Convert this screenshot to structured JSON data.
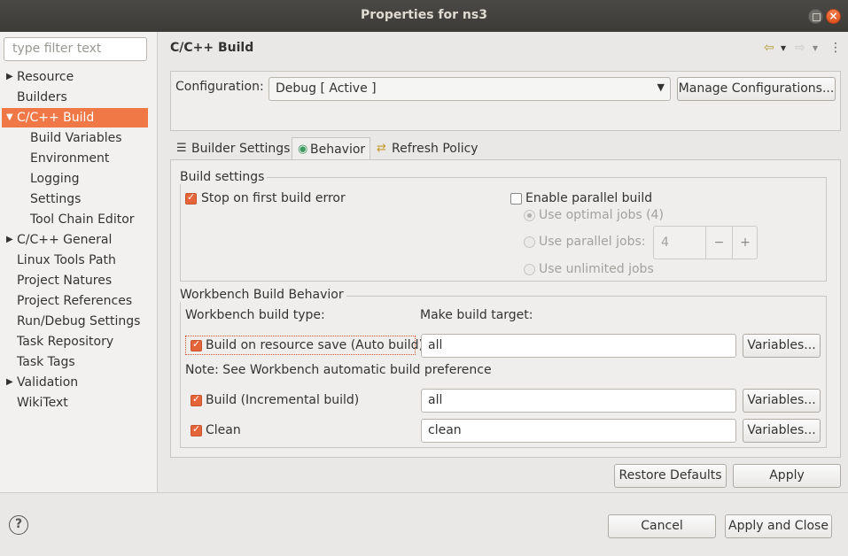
{
  "window": {
    "title": "Properties for ns3"
  },
  "filter": {
    "placeholder": "type filter text"
  },
  "tree": {
    "resource": "Resource",
    "builders": "Builders",
    "cc_build": "C/C++ Build",
    "build_variables": "Build Variables",
    "environment": "Environment",
    "logging": "Logging",
    "settings": "Settings",
    "tool_chain_editor": "Tool Chain Editor",
    "cc_general": "C/C++ General",
    "linux_tools_path": "Linux Tools Path",
    "project_natures": "Project Natures",
    "project_references": "Project References",
    "run_debug_settings": "Run/Debug Settings",
    "task_repository": "Task Repository",
    "task_tags": "Task Tags",
    "validation": "Validation",
    "wikitext": "WikiText"
  },
  "page": {
    "title": "C/C++ Build"
  },
  "config": {
    "label": "Configuration:",
    "value": "Debug  [ Active ]",
    "manage_button": "Manage Configurations..."
  },
  "tabs": {
    "builder_settings": "Builder Settings",
    "behavior": "Behavior",
    "refresh_policy": "Refresh Policy"
  },
  "build_settings": {
    "legend": "Build settings",
    "stop_on_error": "Stop on first build error",
    "enable_parallel": "Enable parallel build",
    "optimal_jobs": "Use optimal jobs (4)",
    "parallel_jobs": "Use parallel jobs:",
    "parallel_jobs_value": "4",
    "unlimited_jobs": "Use unlimited jobs",
    "minus": "−",
    "plus": "+"
  },
  "workbench": {
    "legend": "Workbench Build Behavior",
    "build_type_label": "Workbench build type:",
    "make_target_label": "Make build target:",
    "auto_build": "Build on resource save (Auto build)",
    "auto_build_target": "all",
    "note": "Note: See Workbench automatic build preference",
    "incremental": "Build (Incremental build)",
    "incremental_target": "all",
    "clean": "Clean",
    "clean_target": "clean",
    "variables_button": "Variables..."
  },
  "buttons": {
    "restore_defaults": "Restore Defaults",
    "apply": "Apply",
    "cancel": "Cancel",
    "apply_and_close": "Apply and Close"
  },
  "icons": {
    "help": "?",
    "back_arrow": "⇦",
    "forward_arrow": "⇨",
    "dropdown": "▾",
    "menu": "⋮"
  },
  "colors": {
    "accent": "#f07746",
    "titlebar": "#3c3b37"
  }
}
